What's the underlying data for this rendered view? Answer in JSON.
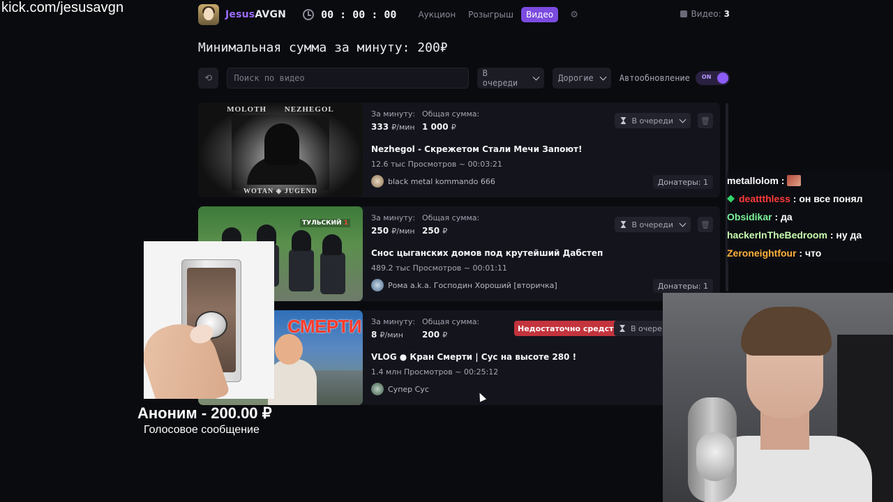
{
  "overlay": {
    "stream_url": "kick.com/jesusavgn",
    "alert_name": "Аноним - 200.00 ₽",
    "alert_message": "Голосовое сообщение"
  },
  "header": {
    "brand_part1": "Jesus",
    "brand_part2": "AVGN",
    "timer": "00 : 00 : 00",
    "nav": [
      "Аукцион",
      "Розыгрыш",
      "Видео"
    ],
    "active_nav": "Видео",
    "video_count_label": "Видео:",
    "video_count": "3"
  },
  "headline": "Минимальная сумма за минуту: 200₽",
  "filters": {
    "search_placeholder": "Поиск по видео",
    "status_filter": "В очереди",
    "sort_filter": "Дорогие",
    "autoupdate_label": "Автообновление",
    "autoupdate_state": "ON"
  },
  "labels": {
    "per_minute": "За минуту:",
    "total": "Общая сумма:"
  },
  "videos": [
    {
      "per_minute": "333",
      "per_minute_unit": "₽/мин",
      "total": "1 000",
      "total_unit": "₽",
      "title": "Nezhegol - Скрежетом Стали Мечи Запоют!",
      "meta": "12.6 тыс Просмотров ~ 00:03:21",
      "channel": "black metal kommando 666",
      "status": "В очереди",
      "donors": "Донатеры: 1",
      "thumb_top": "MOLOTH NEZHEGOL",
      "thumb_bottom": "WOTAN ◈ JUGEND"
    },
    {
      "per_minute": "250",
      "per_minute_unit": "₽/мин",
      "total": "250",
      "total_unit": "₽",
      "title": "Снос цыганских домов под крутейший Дабстеп",
      "meta": "489.2 тыс Просмотров ~ 00:01:11",
      "channel": "Рома a.k.a. Господин Хороший [вторичка]",
      "status": "В очереди",
      "donors": "Донатеры: 1",
      "thumb_logo": "ТУЛЬСКИЙ"
    },
    {
      "per_minute": "8",
      "per_minute_unit": "₽/мин",
      "total": "200",
      "total_unit": "₽",
      "title": "VLOG ● Кран Смерти | Сус на высоте 280 !",
      "meta": "1.4 млн Просмотров ~ 00:25:12",
      "channel": "Супер Сус",
      "status": "В очере",
      "warning": "Недостаточно средств",
      "thumb_text": "СМЕРТИ"
    }
  ],
  "chat": [
    {
      "user": "metallolom",
      "text": "",
      "color": "#ffffff",
      "emote": true
    },
    {
      "user": "deattthless",
      "text": "он все понял",
      "color": "#ff3b3b",
      "badge": true
    },
    {
      "user": "Obsidikar",
      "text": "да",
      "color": "#7cf29a"
    },
    {
      "user": "hackerInTheBedroom",
      "text": "ну да",
      "color": "#c8ffb0"
    },
    {
      "user": "Zeroneightfour",
      "text": "что",
      "color": "#ffb13b"
    }
  ],
  "colors": {
    "accent": "#7b4be0",
    "warning": "#c3343d",
    "background": "#0a0b0f",
    "card": "#14151c"
  },
  "icons": [
    "clock-icon",
    "gear-icon",
    "refresh-icon",
    "chevron-down-icon",
    "hourglass-icon",
    "trash-icon",
    "video-icon"
  ]
}
